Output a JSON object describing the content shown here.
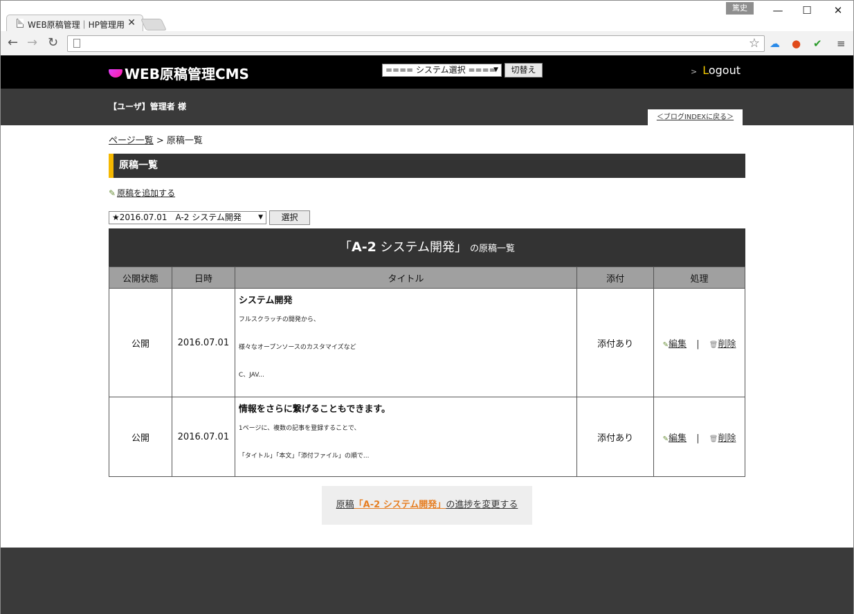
{
  "browser": {
    "tab_title": "WEB原稿管理｜HP管理用",
    "tab_close": "✕",
    "profile_name": "篤史",
    "url": ""
  },
  "header": {
    "logo_text": "WEB原稿管理CMS",
    "system_select_value": "==== システム選択 ====",
    "switch_button": "切替え",
    "logout_prefix": "L",
    "logout_rest": "ogout",
    "user_label": "【ユーザ】管理者 様",
    "blog_back_link": "＜ブログINDEXに戻る＞"
  },
  "breadcrumb": {
    "page_list": "ページ一覧",
    "separator": " > ",
    "current": "原稿一覧"
  },
  "section": {
    "title": "原稿一覧",
    "add_link": "原稿を追加する",
    "date_select_value": "★2016.07.01　A-2 システム開発",
    "select_button": "選択"
  },
  "list": {
    "open_quote": "「",
    "name": "A-2",
    "name_rest": " システム開発",
    "close_quote": "」",
    "suffix": "の原稿一覧",
    "columns": [
      "公開状態",
      "日時",
      "タイトル",
      "添付",
      "処理"
    ],
    "rows": [
      {
        "status": "公開",
        "date": "2016.07.01",
        "title": "システム開発",
        "lines": [
          "フルスクラッチの開発から、",
          "様々なオープンソースのカスタマイズなど",
          "C、JAV..."
        ],
        "attachment": "添付あり",
        "edit": "編集",
        "sep": "|",
        "delete": "削除"
      },
      {
        "status": "公開",
        "date": "2016.07.01",
        "title": "情報をさらに繋げることもできます。",
        "lines": [
          "1ページに、複数の記事を登録することで、",
          "「タイトル」「本文」「添付ファイル」の順で..."
        ],
        "attachment": "添付あり",
        "edit": "編集",
        "sep": "|",
        "delete": "削除"
      }
    ]
  },
  "progress": {
    "prefix": "原稿",
    "highlight": "「A-2 システム開発」",
    "suffix": "の進捗を変更する"
  },
  "colors": {
    "accent": "#f5b800",
    "highlight": "#e67e22",
    "header_bg": "#000000",
    "subheader_bg": "#3a3a3a"
  }
}
